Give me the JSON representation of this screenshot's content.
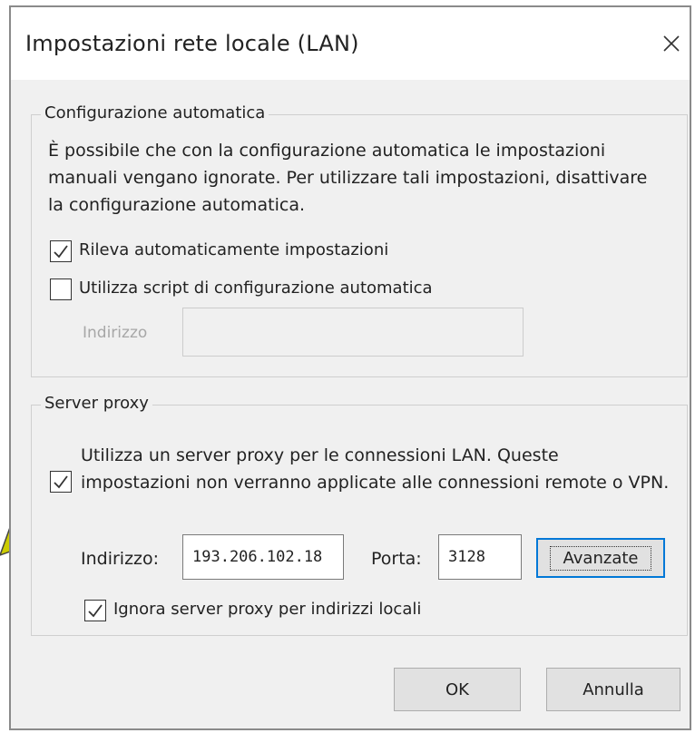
{
  "dialog": {
    "title": "Impostazioni rete locale (LAN)",
    "close_icon": "close-icon"
  },
  "auto_config": {
    "group_title": "Configurazione automatica",
    "description": "È possibile che con la configurazione automatica le impostazioni manuali vengano ignorate. Per utilizzare tali impostazioni, disattivare la configurazione automatica.",
    "auto_detect": {
      "label": "Rileva automaticamente impostazioni",
      "checked": true
    },
    "use_script": {
      "label": "Utilizza script di configurazione automatica",
      "checked": false
    },
    "address_label": "Indirizzo",
    "address_value": ""
  },
  "proxy": {
    "group_title": "Server proxy",
    "use_proxy": {
      "label": "Utilizza un server proxy per le connessioni LAN. Queste impostazioni non verranno applicate alle connessioni remote o VPN.",
      "checked": true
    },
    "address_label": "Indirizzo:",
    "address_value": "193.206.102.18",
    "port_label": "Porta:",
    "port_value": "3128",
    "advanced_label": "Avanzate",
    "bypass_local": {
      "label": "Ignora server proxy per indirizzi locali",
      "checked": true
    }
  },
  "footer": {
    "ok_label": "OK",
    "cancel_label": "Annulla"
  },
  "annotation": {
    "arrow_color": "#cccc00"
  },
  "colors": {
    "dialog_bg": "#f0f0f0",
    "titlebar_bg": "#ffffff",
    "focus_border": "#0078d7"
  }
}
